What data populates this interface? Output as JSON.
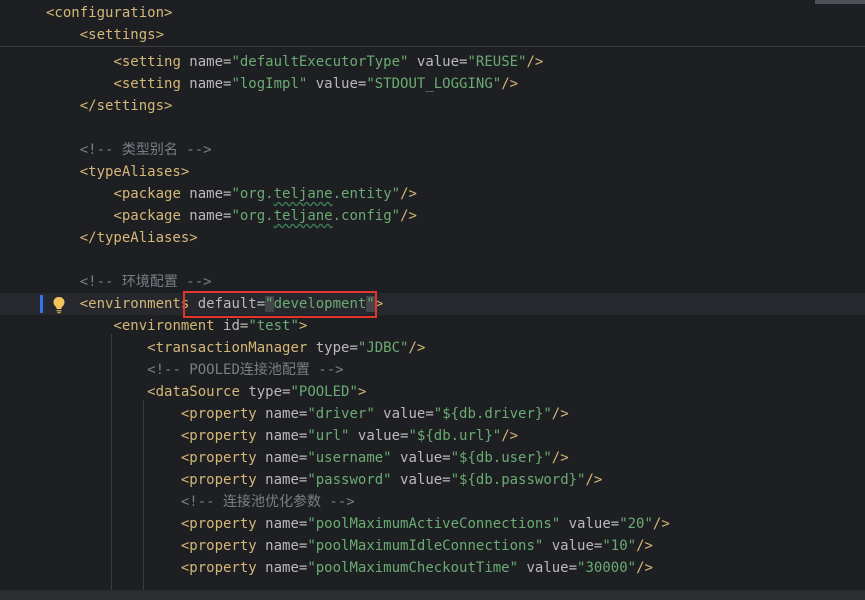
{
  "editor": {
    "language": "XML",
    "sticky_lines": [
      {
        "indent": "",
        "parts": [
          [
            "tag",
            "<configuration>"
          ]
        ]
      },
      {
        "indent": "    ",
        "parts": [
          [
            "tag",
            "<settings>"
          ]
        ]
      }
    ],
    "lines": [
      {
        "indent": "        ",
        "parts": [
          [
            "tag",
            "<setting "
          ],
          [
            "attr",
            "name="
          ],
          [
            "str",
            "\"defaultExecutorType\""
          ],
          [
            "attr",
            " value="
          ],
          [
            "str",
            "\"REUSE\""
          ],
          [
            "tag",
            "/>"
          ]
        ]
      },
      {
        "indent": "        ",
        "parts": [
          [
            "tag",
            "<setting "
          ],
          [
            "attr",
            "name="
          ],
          [
            "str",
            "\"logImpl\""
          ],
          [
            "attr",
            " value="
          ],
          [
            "str",
            "\"STDOUT_LOGGING\""
          ],
          [
            "tag",
            "/>"
          ]
        ]
      },
      {
        "indent": "    ",
        "parts": [
          [
            "tag",
            "</settings>"
          ]
        ]
      },
      {
        "indent": "",
        "parts": []
      },
      {
        "indent": "    ",
        "parts": [
          [
            "cmt",
            "<!-- 类型别名 -->"
          ]
        ]
      },
      {
        "indent": "    ",
        "parts": [
          [
            "tag",
            "<typeAliases>"
          ]
        ]
      },
      {
        "indent": "        ",
        "parts": [
          [
            "tag",
            "<package "
          ],
          [
            "attr",
            "name="
          ],
          [
            "str",
            "\"org."
          ],
          [
            "strtypo",
            "teljane"
          ],
          [
            "str",
            ".entity\""
          ],
          [
            "tag",
            "/>"
          ]
        ]
      },
      {
        "indent": "        ",
        "parts": [
          [
            "tag",
            "<package "
          ],
          [
            "attr",
            "name="
          ],
          [
            "str",
            "\"org."
          ],
          [
            "strtypo",
            "teljane"
          ],
          [
            "str",
            ".config\""
          ],
          [
            "tag",
            "/>"
          ]
        ]
      },
      {
        "indent": "    ",
        "parts": [
          [
            "tag",
            "</typeAliases>"
          ]
        ]
      },
      {
        "indent": "",
        "parts": []
      },
      {
        "indent": "    ",
        "parts": [
          [
            "cmt",
            "<!-- 环境配置 -->"
          ]
        ]
      },
      {
        "indent": "    ",
        "current": true,
        "parts": [
          [
            "tag",
            "<environments "
          ],
          [
            "attr",
            "default="
          ],
          [
            "qhl",
            "\""
          ],
          [
            "str",
            "development"
          ],
          [
            "qhl",
            "\""
          ],
          [
            "tag",
            ">"
          ]
        ]
      },
      {
        "indent": "        ",
        "parts": [
          [
            "tag",
            "<environment "
          ],
          [
            "attr",
            "id="
          ],
          [
            "str",
            "\"test\""
          ],
          [
            "tag",
            ">"
          ]
        ]
      },
      {
        "indent": "            ",
        "parts": [
          [
            "tag",
            "<transactionManager "
          ],
          [
            "attr",
            "type="
          ],
          [
            "str",
            "\"JDBC\""
          ],
          [
            "tag",
            "/>"
          ]
        ]
      },
      {
        "indent": "            ",
        "parts": [
          [
            "cmt",
            "<!-- POOLED连接池配置 -->"
          ]
        ]
      },
      {
        "indent": "            ",
        "parts": [
          [
            "tag",
            "<dataSource "
          ],
          [
            "attr",
            "type="
          ],
          [
            "str",
            "\"POOLED\""
          ],
          [
            "tag",
            ">"
          ]
        ]
      },
      {
        "indent": "                ",
        "parts": [
          [
            "tag",
            "<property "
          ],
          [
            "attr",
            "name="
          ],
          [
            "str",
            "\"driver\""
          ],
          [
            "attr",
            " value="
          ],
          [
            "str",
            "\"${db.driver}\""
          ],
          [
            "tag",
            "/>"
          ]
        ]
      },
      {
        "indent": "                ",
        "parts": [
          [
            "tag",
            "<property "
          ],
          [
            "attr",
            "name="
          ],
          [
            "str",
            "\"url\""
          ],
          [
            "attr",
            " value="
          ],
          [
            "str",
            "\"${db.url}\""
          ],
          [
            "tag",
            "/>"
          ]
        ]
      },
      {
        "indent": "                ",
        "parts": [
          [
            "tag",
            "<property "
          ],
          [
            "attr",
            "name="
          ],
          [
            "str",
            "\"username\""
          ],
          [
            "attr",
            " value="
          ],
          [
            "str",
            "\"${db.user}\""
          ],
          [
            "tag",
            "/>"
          ]
        ]
      },
      {
        "indent": "                ",
        "parts": [
          [
            "tag",
            "<property "
          ],
          [
            "attr",
            "name="
          ],
          [
            "str",
            "\"password\""
          ],
          [
            "attr",
            " value="
          ],
          [
            "str",
            "\"${db.password}\""
          ],
          [
            "tag",
            "/>"
          ]
        ]
      },
      {
        "indent": "                ",
        "parts": [
          [
            "cmt",
            "<!-- 连接池优化参数 -->"
          ]
        ]
      },
      {
        "indent": "                ",
        "parts": [
          [
            "tag",
            "<property "
          ],
          [
            "attr",
            "name="
          ],
          [
            "str",
            "\"poolMaximumActiveConnections\""
          ],
          [
            "attr",
            " value="
          ],
          [
            "str",
            "\"20\""
          ],
          [
            "tag",
            "/>"
          ]
        ]
      },
      {
        "indent": "                ",
        "parts": [
          [
            "tag",
            "<property "
          ],
          [
            "attr",
            "name="
          ],
          [
            "str",
            "\"poolMaximumIdleConnections\""
          ],
          [
            "attr",
            " value="
          ],
          [
            "str",
            "\"10\""
          ],
          [
            "tag",
            "/>"
          ]
        ]
      },
      {
        "indent": "                ",
        "parts": [
          [
            "tag",
            "<property "
          ],
          [
            "attr",
            "name="
          ],
          [
            "str",
            "\"poolMaximumCheckoutTime\""
          ],
          [
            "attr",
            " value="
          ],
          [
            "str",
            "\"30000\""
          ],
          [
            "tag",
            "/>"
          ]
        ]
      }
    ]
  },
  "colors": {
    "background": "#1e1f22",
    "tag": "#d5b778",
    "attribute": "#bababa",
    "string": "#6aab73",
    "comment": "#7a7e85",
    "highlight_box": "#e5332d",
    "caret_line_marker": "#3574f0",
    "intention_bulb": "#f2c55c"
  },
  "icons": {
    "intention_bulb": "lightbulb-icon"
  }
}
